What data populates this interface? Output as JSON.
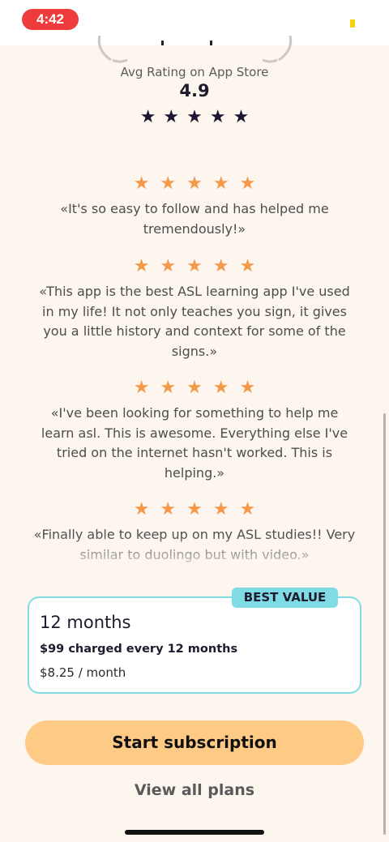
{
  "status_bar": {
    "time": "4:42"
  },
  "rating": {
    "label": "Avg Rating on App Store",
    "value": "4.9",
    "stars": "★★★★★"
  },
  "reviews": [
    {
      "stars": "★★★★★",
      "text": "«It's so easy to follow and has helped me tremendously!»"
    },
    {
      "stars": "★★★★★",
      "text": "«This app is the best ASL learning app I've used in my life! It not only teaches you sign, it gives you a little history and context for some of the signs.»"
    },
    {
      "stars": "★★★★★",
      "text": "«I've been looking for something to help me learn asl. This is awesome. Everything else I've tried on the internet hasn't worked. This is helping.»"
    },
    {
      "stars": "★★★★★",
      "text": "«Finally able to keep up on my ASL studies!! Very similar to duolingo but with video.»"
    }
  ],
  "plan": {
    "badge": "BEST VALUE",
    "title": "12 months",
    "charge": "$99 charged every 12 months",
    "monthly": "$8.25 / month"
  },
  "cta_label": "Start subscription",
  "link_label": "View all plans",
  "colors": {
    "accent": "#fecb87",
    "star": "#f4994a",
    "card_border": "#7fdce5",
    "time_pill": "#ee3b3b"
  }
}
